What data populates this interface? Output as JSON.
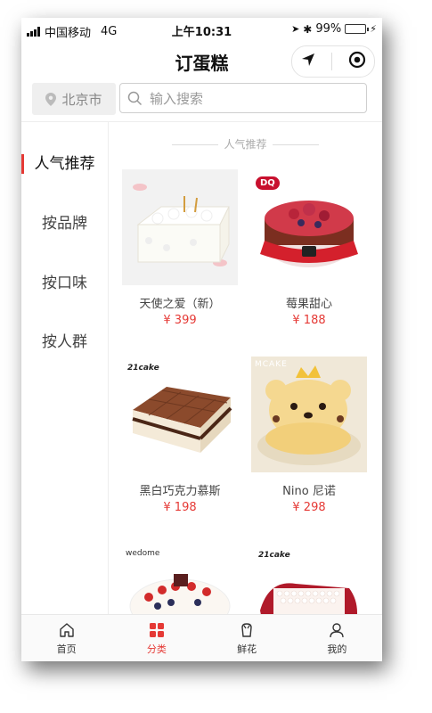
{
  "status": {
    "carrier": "中国移动",
    "network": "4G",
    "time": "上午10:31",
    "battery_percent": "99%",
    "battery_level": 0.99
  },
  "header": {
    "title": "订蛋糕"
  },
  "search": {
    "city": "北京市",
    "placeholder": "输入搜索"
  },
  "sidebar": {
    "items": [
      {
        "label": "人气推荐",
        "active": true
      },
      {
        "label": "按品牌",
        "active": false
      },
      {
        "label": "按口味",
        "active": false
      },
      {
        "label": "按人群",
        "active": false
      }
    ]
  },
  "main": {
    "section_title": "人气推荐",
    "products": [
      {
        "name": "天使之爱（新）",
        "price": "¥ 399"
      },
      {
        "name": "莓果甜心",
        "price": "¥ 188"
      },
      {
        "name": "黑白巧克力慕斯",
        "price": "¥ 198"
      },
      {
        "name": "Nino 尼诺",
        "price": "¥ 298"
      }
    ],
    "brand_marks": [
      "DQ",
      "21cake",
      "MCAKE",
      "wedome",
      "21cake"
    ]
  },
  "tabbar": {
    "items": [
      {
        "label": "首页",
        "icon": "home-icon"
      },
      {
        "label": "分类",
        "icon": "category-icon"
      },
      {
        "label": "鲜花",
        "icon": "flower-icon"
      },
      {
        "label": "我的",
        "icon": "user-icon"
      }
    ]
  },
  "colors": {
    "accent": "#e53935",
    "battery": "#3cc43c"
  }
}
